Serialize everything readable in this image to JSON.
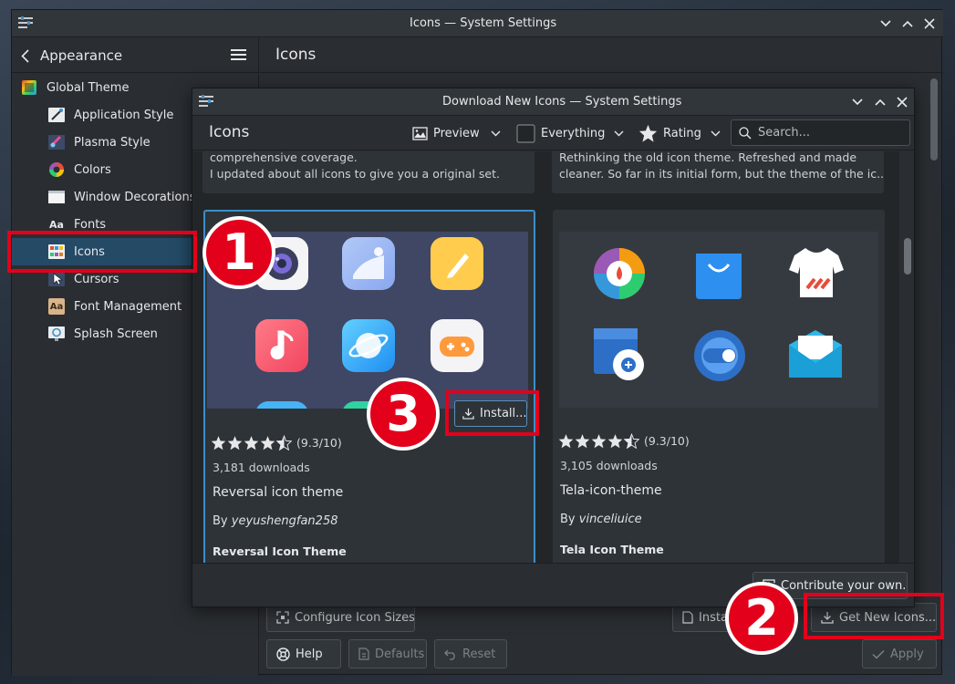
{
  "colors": {
    "accent": "#3d8ec9",
    "selection": "#244a66",
    "annotation": "#e3001b",
    "star": "#e6e8ea"
  },
  "main_window": {
    "title": "Icons — System Settings",
    "sidebar": {
      "back_label": "Appearance",
      "items": [
        {
          "label": "Global Theme",
          "icon": "global-theme-icon"
        },
        {
          "label": "Application Style",
          "icon": "application-style-icon"
        },
        {
          "label": "Plasma Style",
          "icon": "plasma-style-icon"
        },
        {
          "label": "Colors",
          "icon": "colors-icon"
        },
        {
          "label": "Window Decorations",
          "icon": "window-decorations-icon"
        },
        {
          "label": "Fonts",
          "icon": "fonts-icon",
          "glyph": "Aa"
        },
        {
          "label": "Icons",
          "icon": "icons-icon",
          "selected": true
        },
        {
          "label": "Cursors",
          "icon": "cursors-icon"
        },
        {
          "label": "Font Management",
          "icon": "font-management-icon",
          "glyph": "Aa"
        },
        {
          "label": "Splash Screen",
          "icon": "splash-screen-icon"
        }
      ]
    },
    "page_title": "Icons",
    "buttons": {
      "configure_icon_sizes": "Configure Icon Sizes",
      "install_from_file": "Insta",
      "get_new_icons": "Get New Icons...",
      "help": "Help",
      "defaults": "Defaults",
      "reset": "Reset",
      "apply": "Apply"
    }
  },
  "dialog": {
    "title": "Download New Icons — System Settings",
    "heading": "Icons",
    "toolbar": {
      "view_mode": "Preview",
      "filter": "Everything",
      "sort": "Rating",
      "search_placeholder": "Search..."
    },
    "top_cards": [
      {
        "line1": "comprehensive coverage.",
        "line2": "I updated about all icons to give you a original set."
      },
      {
        "line1": "Rethinking the old icon theme. Refreshed and made",
        "line2": "cleaner. So far in its initial form, but the theme of the ic..."
      }
    ],
    "cards": [
      {
        "rating_stars": 4.5,
        "rating_text": "(9.3/10)",
        "downloads": "3,181 downloads",
        "name": "Reversal icon theme",
        "by": "By",
        "author": "yeyushengfan258",
        "subtitle": "Reversal Icon Theme",
        "install_label": "Install..."
      },
      {
        "rating_stars": 4.5,
        "rating_text": "(9.3/10)",
        "downloads": "3,105 downloads",
        "name": "Tela-icon-theme",
        "by": "By",
        "author": "vinceliuice",
        "subtitle": "Tela Icon Theme"
      }
    ],
    "contribute_label": "Contribute your own..."
  },
  "annotations": {
    "step1": "1",
    "step2": "2",
    "step3": "3"
  }
}
